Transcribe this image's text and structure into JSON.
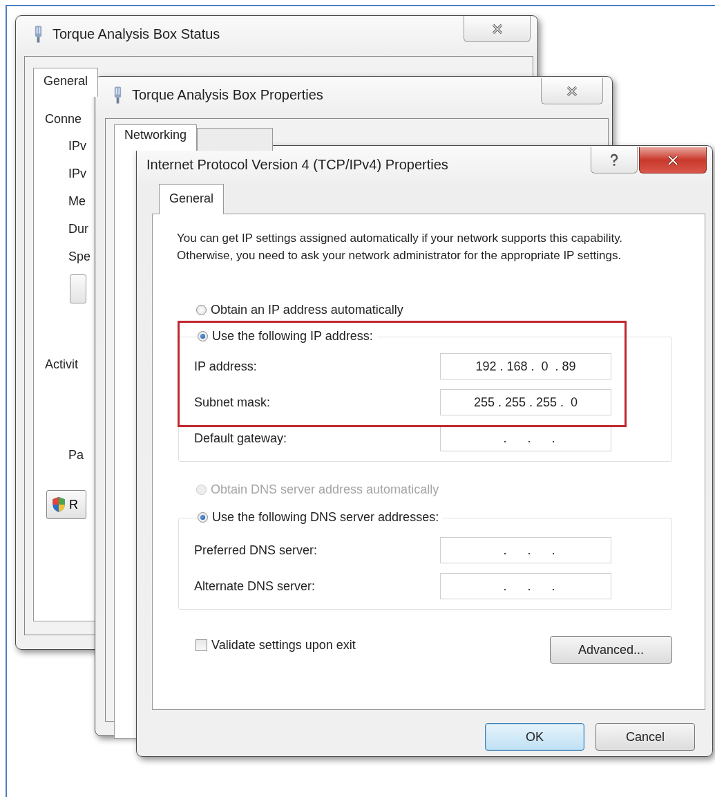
{
  "status_window": {
    "title": "Torque Analysis Box Status",
    "tabs": [
      {
        "label": "General",
        "selected": true
      }
    ],
    "connection": {
      "heading": "Conne",
      "rows": [
        "IPv",
        "IPv",
        "Me",
        "Dur",
        "Spe"
      ]
    },
    "activity": {
      "heading": "Activit",
      "row": "Pa"
    },
    "shield_button": "R"
  },
  "properties_window": {
    "title": "Torque Analysis Box Properties",
    "tabs": [
      {
        "label": "Networking",
        "selected": true
      },
      {
        "selected": false
      }
    ]
  },
  "dialog": {
    "title": "Internet Protocol Version 4 (TCP/IPv4) Properties",
    "tabs": [
      {
        "label": "General",
        "selected": true
      }
    ],
    "description": "You can get IP settings assigned automatically if your network supports this capability. Otherwise, you need to ask your network administrator for the appropriate IP settings.",
    "ip_mode": [
      {
        "label": "Obtain an IP address automatically",
        "selected": false,
        "disabled": false
      },
      {
        "label": "Use the following IP address:",
        "selected": true,
        "disabled": false
      }
    ],
    "ip_fields": [
      {
        "label": "IP address:",
        "value": "192 . 168 .  0  . 89"
      },
      {
        "label": "Subnet mask:",
        "value": "255 . 255 . 255 .  0"
      },
      {
        "label": "Default gateway:",
        "value": "  .      .      ."
      }
    ],
    "dns_mode": [
      {
        "label": "Obtain DNS server address automatically",
        "selected": false,
        "disabled": true
      },
      {
        "label": "Use the following DNS server addresses:",
        "selected": true,
        "disabled": false
      }
    ],
    "dns_fields": [
      {
        "label": "Preferred DNS server:",
        "value": "  .      .      ."
      },
      {
        "label": "Alternate DNS server:",
        "value": "  .      .      ."
      }
    ],
    "validate": {
      "label": "Validate settings upon exit",
      "checked": false
    },
    "advanced_button": "Advanced...",
    "buttons": [
      {
        "label": "OK",
        "default": true
      },
      {
        "label": "Cancel",
        "default": false
      }
    ]
  }
}
